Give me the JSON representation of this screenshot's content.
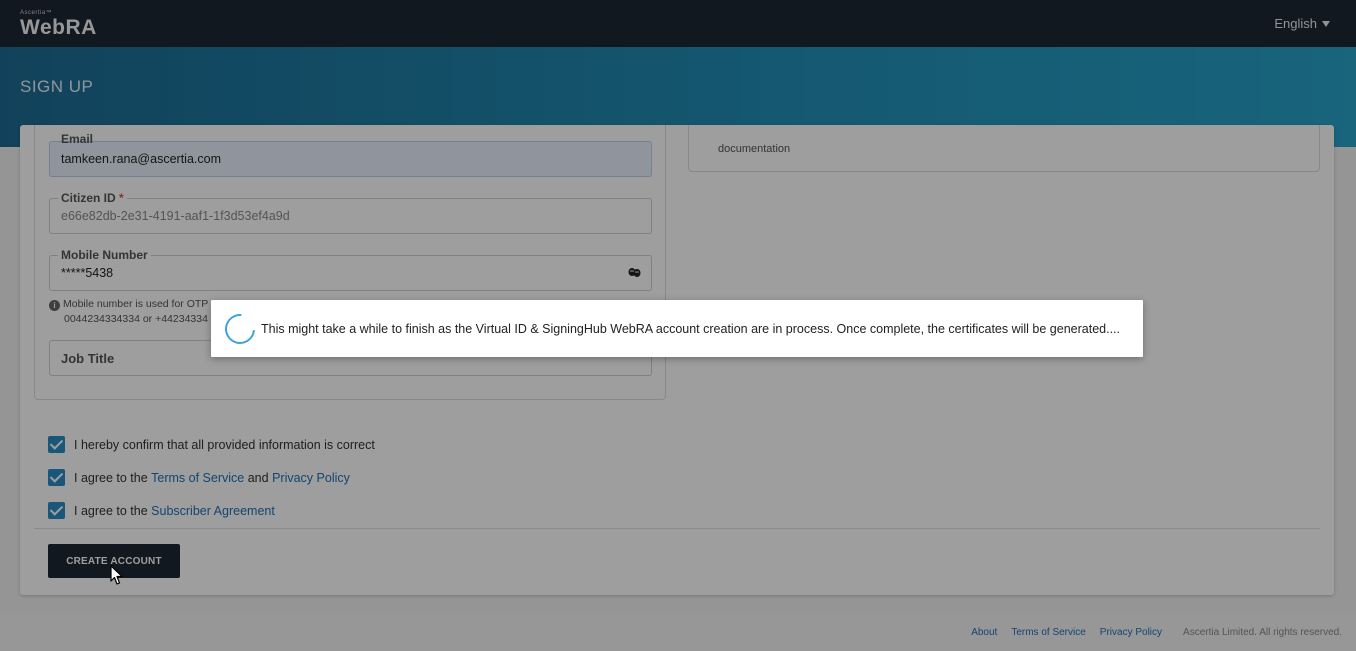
{
  "header": {
    "brand_small": "Ascertia™",
    "brand_name": "WebRA",
    "language": "English"
  },
  "page": {
    "title": "SIGN UP"
  },
  "form": {
    "email": {
      "label": "Email",
      "value": "tamkeen.rana@ascertia.com"
    },
    "citizen_id": {
      "label": "Citizen ID",
      "required_mark": "*",
      "value": "e66e82db-2e31-4191-aaf1-1f3d53ef4a9d"
    },
    "mobile": {
      "label": "Mobile Number",
      "value": "*****5438"
    },
    "mobile_info_line1": "Mobile number is used for OTP",
    "mobile_info_line2": "0044234334334 or +44234334",
    "job_title": {
      "placeholder": "Job Title"
    }
  },
  "right_panel": {
    "text": "documentation"
  },
  "agreements": {
    "confirm": "I hereby confirm that all provided information is correct",
    "terms_prefix": "I agree to the ",
    "terms_link": "Terms of Service",
    "terms_and": " and ",
    "privacy_link": "Privacy Policy",
    "subscriber_prefix": "I agree to the ",
    "subscriber_link": "Subscriber Agreement"
  },
  "actions": {
    "create_account": "CREATE ACCOUNT"
  },
  "footer": {
    "about": "About",
    "terms": "Terms of Service",
    "privacy": "Privacy Policy",
    "copyright": "Ascertia Limited. All rights reserved."
  },
  "modal": {
    "message": "This might take a while to finish as the Virtual ID & SigningHub WebRA account creation are in process. Once complete, the certificates will be generated...."
  }
}
